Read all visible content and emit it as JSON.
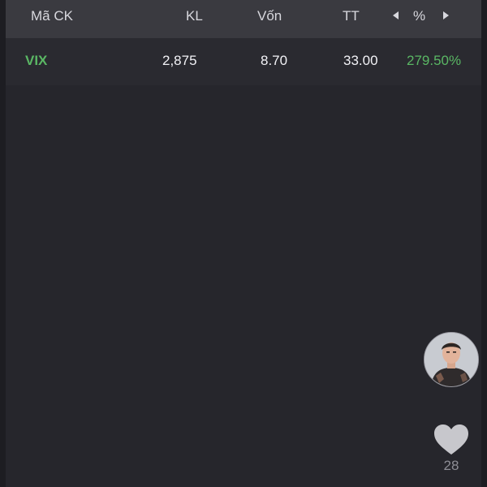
{
  "colors": {
    "background": "#26262c",
    "header_background": "#3a3a40",
    "positive_green": "#5ab764",
    "text": "#f2f2f6"
  },
  "table": {
    "columns": [
      "Mã CK",
      "KL",
      "Vốn",
      "TT",
      "%"
    ],
    "rows": [
      {
        "symbol": "VIX",
        "kl": "2,875",
        "von": "8.70",
        "tt": "33.00",
        "pct": "279.50%"
      }
    ]
  },
  "overlay": {
    "avatar_icon": "user-avatar",
    "like_icon": "heart-icon",
    "like_count": "28"
  }
}
